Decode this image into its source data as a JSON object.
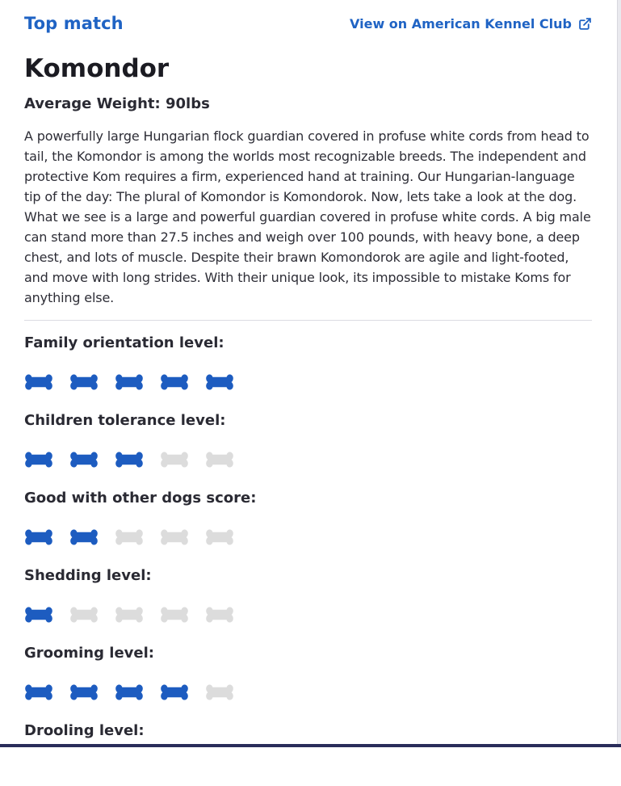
{
  "header": {
    "top_match_label": "Top match",
    "akc_link_label": "View on American Kennel Club",
    "akc_link_icon": "external-link-icon"
  },
  "breed": {
    "name": "Komondor",
    "weight_label": "Average Weight: 90lbs",
    "description": "A powerfully large Hungarian flock guardian covered in profuse white cords from head to tail, the Komondor is among the worlds most recognizable breeds. The independent and protective Kom requires a firm, experienced hand at training. Our Hungarian-language tip of the day: The plural of Komondor is Komondorok. Now, lets take a look at the dog. What we see is a large and powerful guardian covered in profuse white cords. A big male can stand more than 27.5 inches and weigh over 100 pounds, with heavy bone, a deep chest, and lots of muscle. Despite their brawn Komondorok are agile and light-footed, and move with long strides. With their unique look, its impossible to mistake Koms for anything else."
  },
  "rating_scale": {
    "max": 5,
    "icon": "bone-icon",
    "filled_color": "#1d5cc0",
    "empty_color": "#dcdcdc"
  },
  "traits": [
    {
      "label": "Family orientation level:",
      "rating": 5
    },
    {
      "label": "Children tolerance level:",
      "rating": 3
    },
    {
      "label": "Good with other dogs score:",
      "rating": 2
    },
    {
      "label": "Shedding level:",
      "rating": 1
    },
    {
      "label": "Grooming level:",
      "rating": 4
    },
    {
      "label": "Drooling level:",
      "rating": null
    }
  ]
}
